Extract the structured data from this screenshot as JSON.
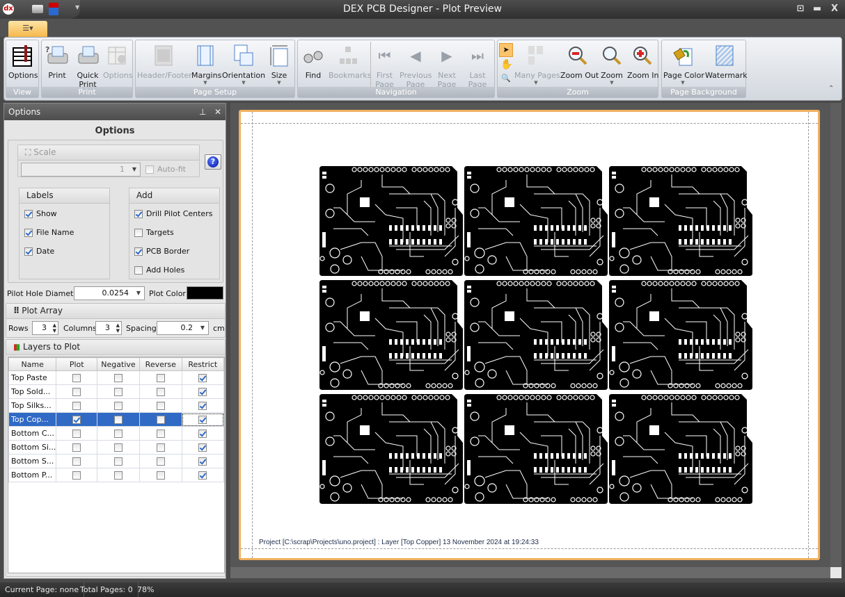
{
  "window": {
    "title": "DEX PCB Designer - Plot Preview",
    "icons": [
      "app-logo-icon",
      "print-icon",
      "pdf-save-icon",
      "customize-dropdown-icon"
    ],
    "controls": [
      "restore-icon",
      "maximize-icon",
      "close-icon"
    ],
    "close_label": "X"
  },
  "ribbon": {
    "groups": [
      {
        "caption": "View",
        "buttons": [
          {
            "label": "Options",
            "enabled": true
          }
        ]
      },
      {
        "caption": "Print",
        "buttons": [
          {
            "label": "Print",
            "enabled": true
          },
          {
            "label": "Quick Print",
            "enabled": true
          },
          {
            "label": "Options",
            "enabled": false
          }
        ]
      },
      {
        "caption": "Page Setup",
        "buttons": [
          {
            "label": "Header/Footer",
            "enabled": false
          },
          {
            "label": "Margins",
            "enabled": true
          },
          {
            "label": "Orientation",
            "enabled": true
          },
          {
            "label": "Size",
            "enabled": true
          }
        ]
      },
      {
        "caption": "Navigation",
        "buttons": [
          {
            "label": "Find",
            "enabled": true
          },
          {
            "label": "Bookmarks",
            "enabled": false
          },
          {
            "label": "First Page",
            "enabled": false
          },
          {
            "label": "Previous Page",
            "enabled": false
          },
          {
            "label": "Next Page",
            "enabled": false
          },
          {
            "label": "Last Page",
            "enabled": false
          }
        ]
      },
      {
        "caption": "Zoom",
        "buttons": [
          {
            "label": "Many Pages",
            "enabled": false
          },
          {
            "label": "Zoom Out",
            "enabled": true
          },
          {
            "label": "Zoom",
            "enabled": true
          },
          {
            "label": "Zoom In",
            "enabled": true
          }
        ]
      },
      {
        "caption": "Page Background",
        "buttons": [
          {
            "label": "Page Color",
            "enabled": true
          },
          {
            "label": "Watermark",
            "enabled": true
          }
        ]
      }
    ],
    "accent": "#f5b84b"
  },
  "options_panel": {
    "header": "Options",
    "title": "Options",
    "scale": {
      "label": "Scale",
      "value": "1",
      "autofit_label": "Auto-fit",
      "autofit": false
    },
    "labels": {
      "title": "Labels",
      "items": [
        {
          "label": "Show",
          "checked": true
        },
        {
          "label": "File Name",
          "checked": true
        },
        {
          "label": "Date",
          "checked": true
        }
      ]
    },
    "add": {
      "title": "Add",
      "items": [
        {
          "label": "Drill Pilot Centers",
          "checked": true
        },
        {
          "label": "Targets",
          "checked": false
        },
        {
          "label": "PCB Border",
          "checked": true
        },
        {
          "label": "Add Holes",
          "checked": false
        }
      ]
    },
    "pilot_hole_label": "Pilot Hole Diameter",
    "pilot_hole_value": "0.0254",
    "plot_color_label": "Plot Color",
    "plot_color": "#000000",
    "plot_array": {
      "title": "Plot Array",
      "rows_label": "Rows",
      "rows": "3",
      "columns_label": "Columns",
      "columns": "3",
      "spacing_label": "Spacing",
      "spacing": "0.2",
      "unit": "cm"
    },
    "layers": {
      "title": "Layers to Plot",
      "columns": [
        "Name",
        "Plot",
        "Negative",
        "Reverse",
        "Restrict"
      ],
      "rows": [
        {
          "name": "Top Paste",
          "plot": false,
          "negative": false,
          "reverse": false,
          "restrict": true
        },
        {
          "name": "Top Sold...",
          "plot": false,
          "negative": false,
          "reverse": false,
          "restrict": true
        },
        {
          "name": "Top Silks...",
          "plot": false,
          "negative": false,
          "reverse": false,
          "restrict": true
        },
        {
          "name": "Top Cop...",
          "plot": true,
          "negative": false,
          "reverse": false,
          "restrict": true,
          "selected": true
        },
        {
          "name": "Bottom C...",
          "plot": false,
          "negative": false,
          "reverse": false,
          "restrict": true
        },
        {
          "name": "Bottom Si...",
          "plot": false,
          "negative": false,
          "reverse": false,
          "restrict": true
        },
        {
          "name": "Bottom S...",
          "plot": false,
          "negative": false,
          "reverse": false,
          "restrict": true
        },
        {
          "name": "Bottom P...",
          "plot": false,
          "negative": false,
          "reverse": false,
          "restrict": true
        }
      ]
    }
  },
  "preview": {
    "footer": "Project [C:\\scrap\\Projects\\uno.project] : Layer [Top Copper] 13 November 2024 at 19:24:33",
    "rows": 3,
    "columns": 3
  },
  "status": {
    "current_page": "Current Page: none",
    "total_pages": "Total Pages: 0",
    "zoom": "78%"
  }
}
